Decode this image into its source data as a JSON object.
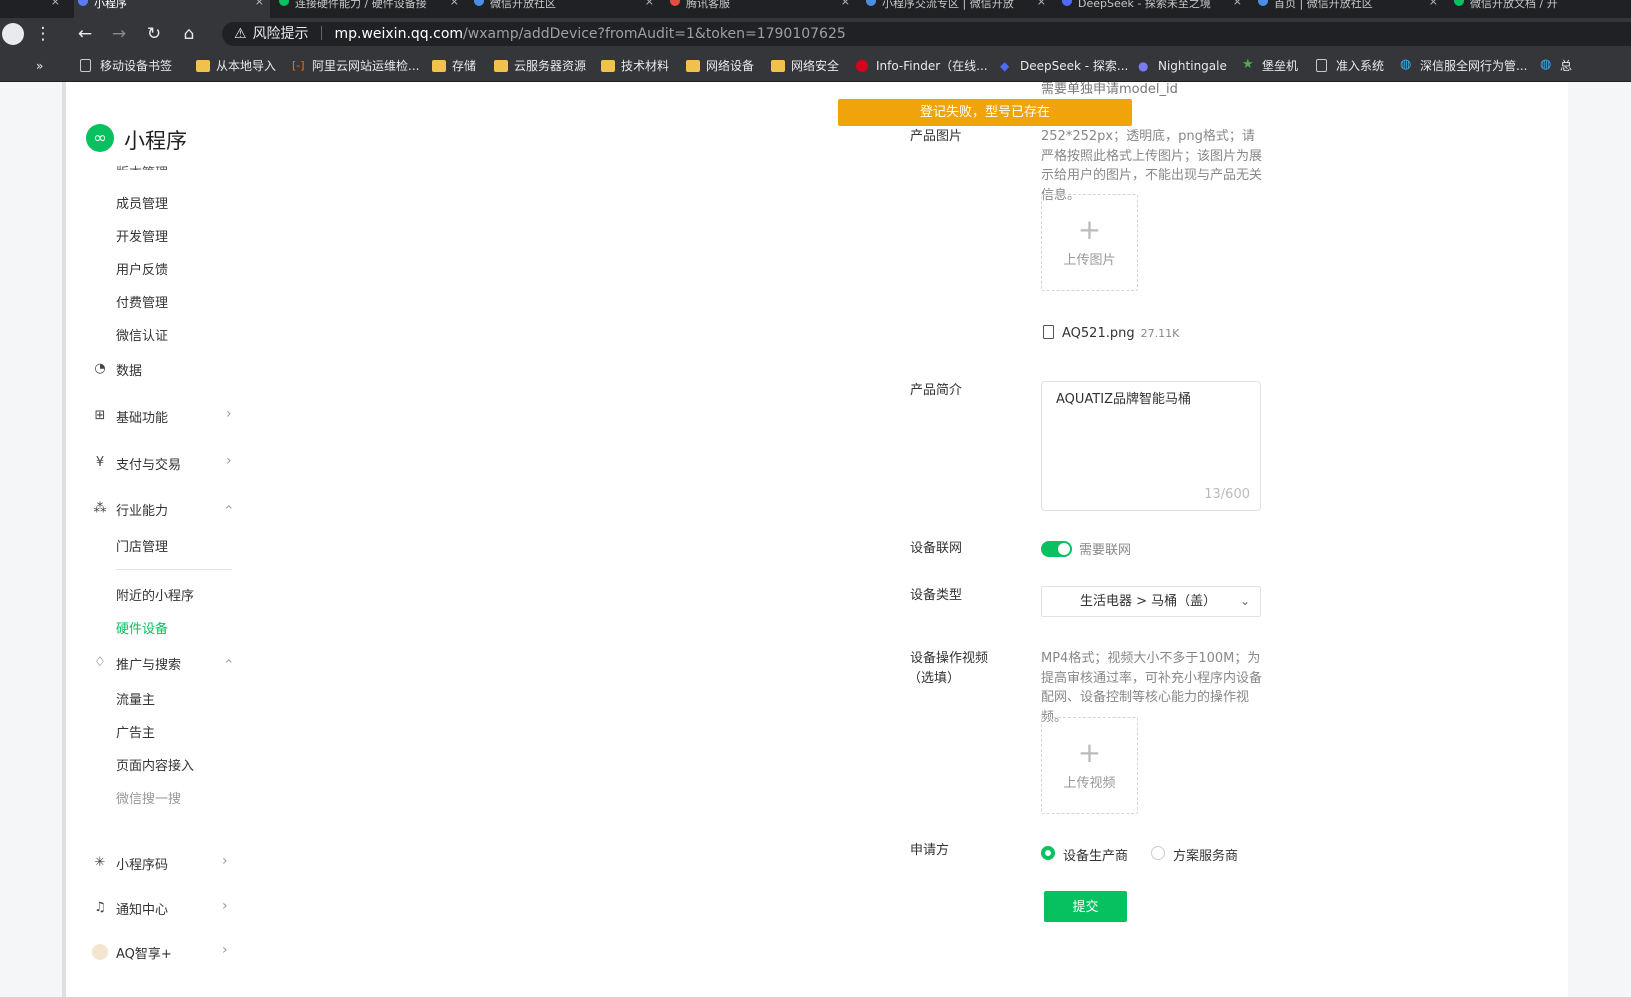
{
  "browser": {
    "tabs": [
      {
        "label": "小程序",
        "active": true
      },
      {
        "label": "连接硬件能力 / 硬件设备接"
      },
      {
        "label": "微信开放社区"
      },
      {
        "label": "腾讯客服"
      },
      {
        "label": "小程序交流专区 | 微信开放"
      },
      {
        "label": "DeepSeek - 探索未至之境"
      },
      {
        "label": "首页 | 微信开放社区"
      },
      {
        "label": "微信开放文档 / 开"
      }
    ],
    "security_label": "风险提示",
    "url_host": "mp.weixin.qq.com",
    "url_path": "/wxamp/addDevice?fromAudit=1&token=1790107625",
    "bookmarks_overflow": "»",
    "bookmarks": [
      {
        "label": "移动设备书签",
        "icon": "page-icon"
      },
      {
        "label": "从本地导入",
        "icon": "folder-icon"
      },
      {
        "label": "阿里云网站运维检...",
        "icon": "aliyun-icon"
      },
      {
        "label": "存储",
        "icon": "folder-icon"
      },
      {
        "label": "云服务器资源",
        "icon": "folder-icon"
      },
      {
        "label": "技术材料",
        "icon": "folder-icon"
      },
      {
        "label": "网络设备",
        "icon": "folder-icon"
      },
      {
        "label": "网络安全",
        "icon": "folder-icon"
      },
      {
        "label": "Info-Finder（在线...",
        "icon": "huawei-icon"
      },
      {
        "label": "DeepSeek - 探索...",
        "icon": "deepseek-icon"
      },
      {
        "label": "Nightingale",
        "icon": "nightingale-icon"
      },
      {
        "label": "堡垒机",
        "icon": "star-icon"
      },
      {
        "label": "准入系统",
        "icon": "page-icon"
      },
      {
        "label": "深信服全网行为管...",
        "icon": "globe-icon"
      },
      {
        "label": "总",
        "icon": "globe-icon"
      }
    ]
  },
  "sidebar": {
    "logo_text": "小程序",
    "clipped_item": "版本管理",
    "items_top": [
      "成员管理",
      "开发管理",
      "用户反馈",
      "付费管理",
      "微信认证"
    ],
    "groups": {
      "data": "数据",
      "basic": "基础功能",
      "pay": "支付与交易",
      "industry": "行业能力",
      "promo": "推广与搜索",
      "qrcode": "小程序码",
      "notify": "通知中心",
      "account": "AQ智享+"
    },
    "industry_items": [
      "门店管理",
      "附近的小程序",
      "硬件设备"
    ],
    "promo_items": [
      "流量主",
      "广告主",
      "页面内容接入",
      "微信搜一搜"
    ]
  },
  "form": {
    "toast": "登记失败，型号已存在",
    "model_hint": "需要单独申请model_id",
    "image_label": "产品图片",
    "image_hint": "252*252px；透明底，png格式；请严格按照此格式上传图片；该图片为展示给用户的图片，不能出现与产品无关信息。",
    "upload_image": "上传图片",
    "file_name": "AQ521.png",
    "file_size": "27.11K",
    "intro_label": "产品简介",
    "intro_value": "AQUATIZ品牌智能马桶",
    "intro_counter": "13/600",
    "network_label": "设备联网",
    "network_toggle_label": "需要联网",
    "network_on": true,
    "type_label": "设备类型",
    "type_value": "生活电器 > 马桶（盖）",
    "video_label": "设备操作视频",
    "video_label_sub": "（选填）",
    "video_hint": "MP4格式；视频大小不多于100M；为提高审核通过率，可补充小程序内设备配网、设备控制等核心能力的操作视频。",
    "upload_video": "上传视频",
    "applicant_label": "申请方",
    "applicant_options": [
      "设备生产商",
      "方案服务商"
    ],
    "applicant_selected": 0,
    "submit": "提交"
  },
  "colors": {
    "accent": "#07c160",
    "toast": "#f0a30a"
  }
}
